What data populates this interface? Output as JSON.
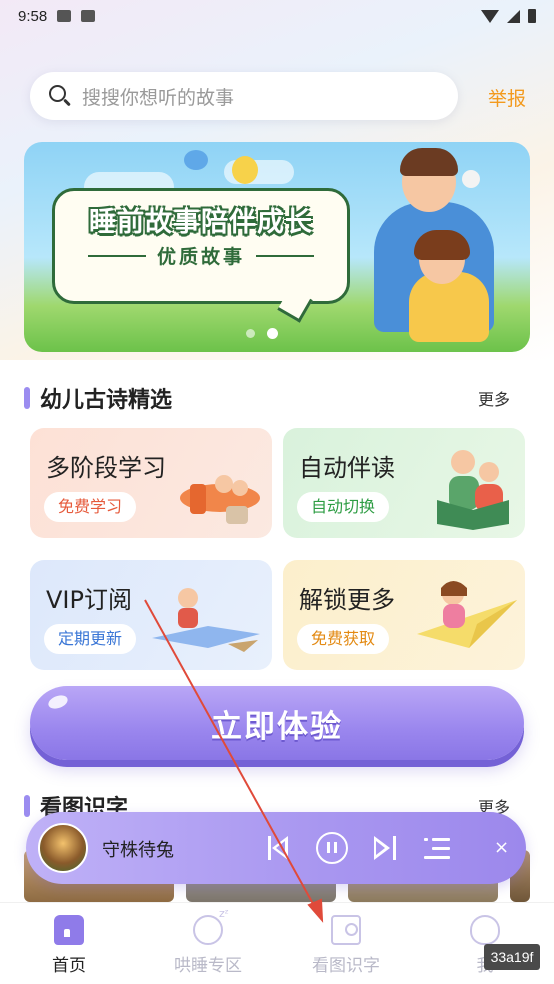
{
  "status_bar": {
    "time": "9:58"
  },
  "search": {
    "placeholder": "搜搜你想听的故事"
  },
  "header": {
    "report_label": "举报"
  },
  "banner": {
    "headline": "睡前故事陪伴成长",
    "subline": "优质故事",
    "active_dot": 1,
    "dot_count": 2
  },
  "section_poems": {
    "title": "幼儿古诗精选",
    "more": "更多"
  },
  "cards": [
    {
      "title": "多阶段学习",
      "tag": "免费学习"
    },
    {
      "title": "自动伴读",
      "tag": "自动切换"
    },
    {
      "title": "VIP订阅",
      "tag": "定期更新"
    },
    {
      "title": "解锁更多",
      "tag": "免费获取"
    }
  ],
  "cta": {
    "label": "立即体验"
  },
  "section_images": {
    "title": "看图识字",
    "more": "更多"
  },
  "player": {
    "title": "守株待兔",
    "close": "×"
  },
  "bottom_nav": [
    {
      "label": "首页",
      "icon": "home-icon",
      "active": true
    },
    {
      "label": "哄睡专区",
      "icon": "sleep-icon",
      "active": false
    },
    {
      "label": "看图识字",
      "icon": "image-search-icon",
      "active": false
    },
    {
      "label": "我",
      "icon": "me-icon",
      "active": false
    }
  ],
  "watermark": "33a19f",
  "colors": {
    "accent": "#9b8cf0",
    "report": "#f39a1e",
    "annotation": "#e04a3a"
  }
}
